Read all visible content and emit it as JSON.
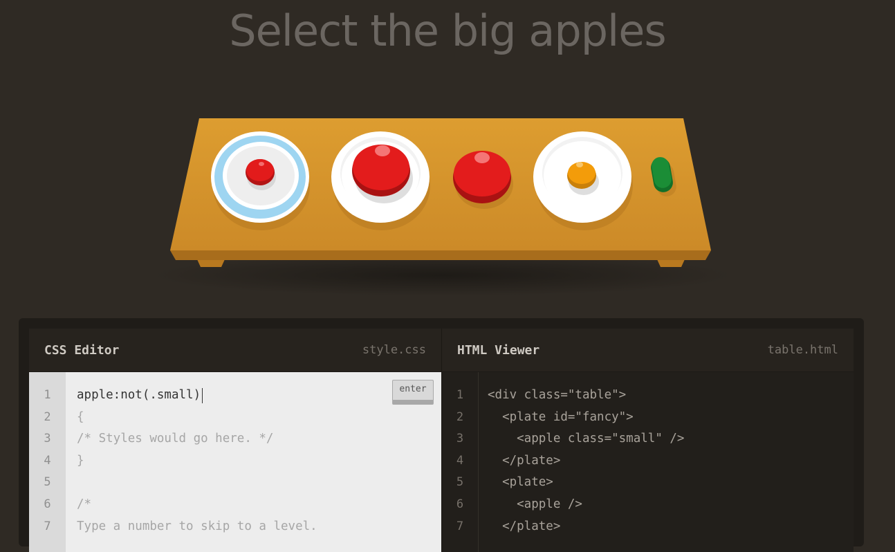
{
  "title": "Select the big apples",
  "css_editor": {
    "title": "CSS Editor",
    "filename": "style.css",
    "enter_label": "enter",
    "line_numbers": [
      "1",
      "2",
      "3",
      "4",
      "5",
      "6",
      "7"
    ],
    "input_value": "apple:not(.small)",
    "lines": [
      "{",
      "/* Styles would go here. */",
      "}",
      "",
      "/*",
      "Type a number to skip to a level."
    ]
  },
  "html_viewer": {
    "title": "HTML Viewer",
    "filename": "table.html",
    "line_numbers": [
      "1",
      "2",
      "3",
      "4",
      "5",
      "6",
      "7"
    ],
    "lines": [
      "<div class=\"table\">",
      "  <plate id=\"fancy\">",
      "    <apple class=\"small\" />",
      "  </plate>",
      "  <plate>",
      "    <apple />",
      "  </plate>"
    ]
  },
  "colors": {
    "background": "#2f2a24",
    "table_top": "#d49a2e",
    "apple_red": "#e01b1b",
    "orange": "#f29b05",
    "pickle_green": "#1b8a35",
    "fancy_plate_ring": "#9fd4f0"
  },
  "table_items": [
    {
      "kind": "fancy-plate",
      "content": "small-apple"
    },
    {
      "kind": "plate",
      "content": "apple"
    },
    {
      "kind": "none",
      "content": "apple"
    },
    {
      "kind": "plate",
      "content": "orange"
    },
    {
      "kind": "none",
      "content": "pickle"
    }
  ]
}
